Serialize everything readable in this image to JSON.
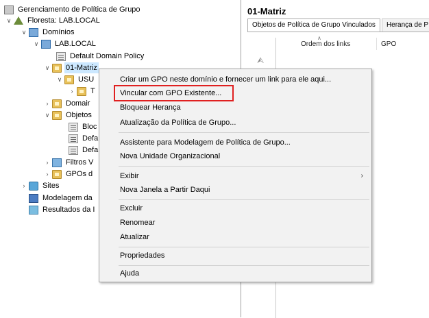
{
  "tree": {
    "root": "Gerenciamento de Política de Grupo",
    "forest": "Floresta: LAB.LOCAL",
    "domains": "Domínios",
    "domain": "LAB.LOCAL",
    "default_domain_policy": "Default Domain Policy",
    "ou_matriz": "01-Matriz",
    "ou_usu": "USU",
    "ou_child": "T",
    "domain_controllers": "Domair",
    "gpo_objects": "Objetos",
    "gpo_1": "Bloc",
    "gpo_2": "Defa",
    "gpo_3": "Defa",
    "wmi_filters": "Filtros V",
    "starter_gpos": "GPOs d",
    "sites": "Sites",
    "modeling": "Modelagem da",
    "results": "Resultados da I"
  },
  "right_pane": {
    "title": "01-Matriz",
    "tabs": [
      "Objetos de Política de Grupo Vinculados",
      "Herança de P"
    ],
    "columns": {
      "order": "Ordem dos links",
      "gpo": "GPO"
    }
  },
  "context_menu": {
    "items": [
      "Criar um GPO neste domínio e fornecer um link para ele aqui...",
      "Vincular com GPO Existente...",
      "Bloquear Herança",
      "Atualização da Política de Grupo...",
      "Assistente para Modelagem de Política de Grupo...",
      "Nova Unidade Organizacional",
      "Exibir",
      "Nova Janela a Partir Daqui",
      "Excluir",
      "Renomear",
      "Atualizar",
      "Propriedades",
      "Ajuda"
    ],
    "highlighted_item": "Vincular com GPO Existente...",
    "highlight_color": "#e02020"
  }
}
